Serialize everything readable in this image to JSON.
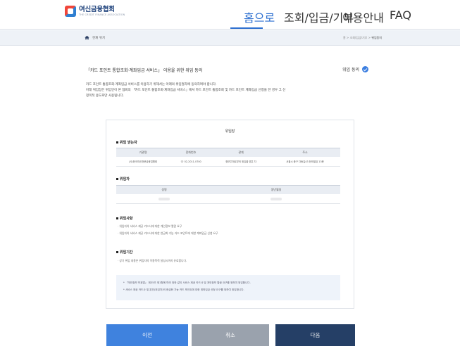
{
  "header": {
    "logo_name": "여신금융협회",
    "logo_sub": "THE CREDIT FINANCE ASSOCIATION",
    "nav": [
      "홈으로",
      "조회/입금/기부",
      "이용안내",
      "FAQ"
    ]
  },
  "breadcrumb": {
    "home_label": "현재 위치",
    "path_home": "홈",
    "path_mid": "조회/입금/기부",
    "path_current": "위임동의",
    "separator": ">"
  },
  "title": "「카드 포인트 통합조회·계좌입금 서비스」 이용을 위한 위임 동의",
  "agree_label": "위임 동의",
  "description": {
    "line1": "카드 포인트 통합조회·계좌입금 서비스를 이용하기 위해서는 아래의 위임절차에 동의하여야 합니다.",
    "line2": "아래 위임장은 위임인이 본 협회의 「카드 포인트 통합조회·계좌입금 서비스」에서 카드 포인트 통합조회 및 카드 포인트 계좌입금 신청을 한 경우 그 신",
    "line3": "청목적 용도로만 사용됩니다."
  },
  "document": {
    "title": "위임장",
    "section_delegate": {
      "title": "위임 받는자",
      "headers": [
        "기관명",
        "전화번호",
        "관계",
        "주소"
      ],
      "row": [
        "(사)한국여신전문금융업협회",
        "☏ 02-2011-0700",
        "정보주체로부터 위임을 받은 자",
        "서울시 중구 다동길43 한외빌딩 13층"
      ]
    },
    "section_grantor": {
      "title": "위임자",
      "headers": [
        "성명",
        "생년월일"
      ]
    },
    "section_matters": {
      "title": "위임사항",
      "items": [
        "· 위임자의 서비스 제공 카드사에 대한 개인정보 열람 요구",
        "· 위임자의 서비스 제공 카드사에 대한 현금화 가능 카드 포인트에 대한 계좌입금 신청 요구"
      ]
    },
    "section_period": {
      "title": "위임기간",
      "items": [
        "· 상기 위임 내용은 위임자의 이용목적 달성시까지 유효합니다."
      ]
    },
    "notice": [
      "* 「개인정보 보호법」 제35조 제1항에 따라 위와 같이 서비스 제공 카드사 및 개인정보 열람 요구를 위하여 위임합니다.",
      "* 서비스 제공 카드사 및 본인(위임자)의 현금화 가능 카드 포인트에 대한 계좌입금 신청 요구를 위하여 위임합니다."
    ]
  },
  "buttons": {
    "prev": "이전",
    "cancel": "취소",
    "next": "다음"
  },
  "colors": {
    "accent": "#2c6fd0",
    "prev_button": "#3f82de",
    "cancel_button": "#9aa2ad",
    "next_button": "#253f66"
  }
}
